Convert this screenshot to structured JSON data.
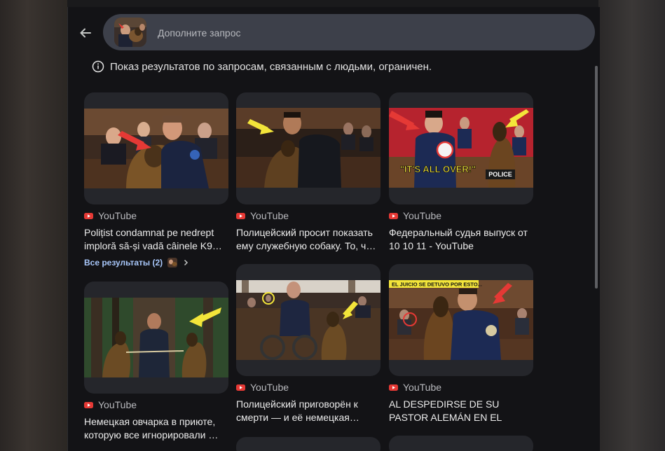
{
  "search": {
    "placeholder": "Дополните запрос"
  },
  "notice": {
    "text": "Показ результатов по запросам, связанным с людьми, ограничен."
  },
  "results": [
    {
      "source": "YouTube",
      "title": "Polițist condamnat pe nedrept imploră să-și vadă câinele K9…"
    },
    {
      "source": "YouTube",
      "title": "Полицейский просит показать ему служебную собаку. То, ч…"
    },
    {
      "source": "YouTube",
      "title": "Федеральный судья выпуск от 10 10 11 - YouTube"
    },
    {
      "source": "YouTube",
      "title": "Немецкая овчарка в приюте, которую все игнорировали …"
    },
    {
      "source": "YouTube",
      "title": "Полицейский приговорён к смерти — и её немецкая…"
    },
    {
      "source": "YouTube",
      "title": "AL DESPEDIRSE DE SU PASTOR ALEMÁN EN EL TRIBUNAL……"
    }
  ],
  "more_results": {
    "label": "Все результаты (2)"
  },
  "thumb_text": {
    "its_all_over": "\"IT'S ALL OVER!\"",
    "police": "POLICE",
    "juicio": "EL JUICIO SE DETUVO POR ESTO..."
  },
  "colors": {
    "panel_bg": "#131316",
    "searchbar_bg": "#3d404a",
    "link_blue": "#a8c7fa",
    "youtube_red": "#e53935",
    "arrow_red": "#e53935",
    "arrow_yellow": "#f3e53a"
  },
  "icons": {
    "back": "arrow-left-icon",
    "notice": "info-icon",
    "source": "youtube-icon",
    "more": "chevron-right-icon"
  }
}
